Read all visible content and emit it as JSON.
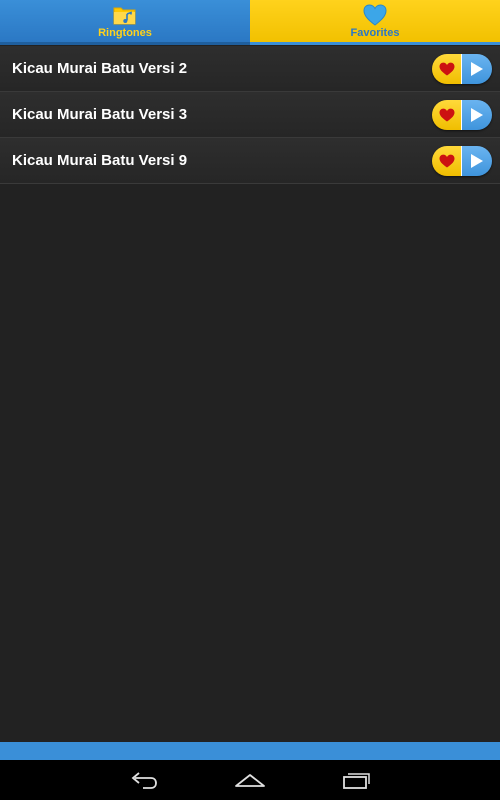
{
  "tabs": [
    {
      "label": "Ringtones",
      "icon": "music-folder-icon",
      "selected": false
    },
    {
      "label": "Favorites",
      "icon": "heart-icon",
      "selected": true
    }
  ],
  "favorites": [
    {
      "title": "Kicau Murai Batu Versi 2"
    },
    {
      "title": "Kicau Murai Batu Versi 3"
    },
    {
      "title": "Kicau Murai Batu Versi 9"
    }
  ],
  "row_actions": {
    "favorite_icon": "heart-icon",
    "play_icon": "play-icon"
  },
  "navigation": {
    "icons": [
      "back-icon",
      "home-icon",
      "recent-apps-icon"
    ]
  },
  "colors": {
    "blue": "#3a8fd8",
    "yellow": "#ffd21c",
    "heart_red": "#cc1111",
    "background": "#222222"
  }
}
